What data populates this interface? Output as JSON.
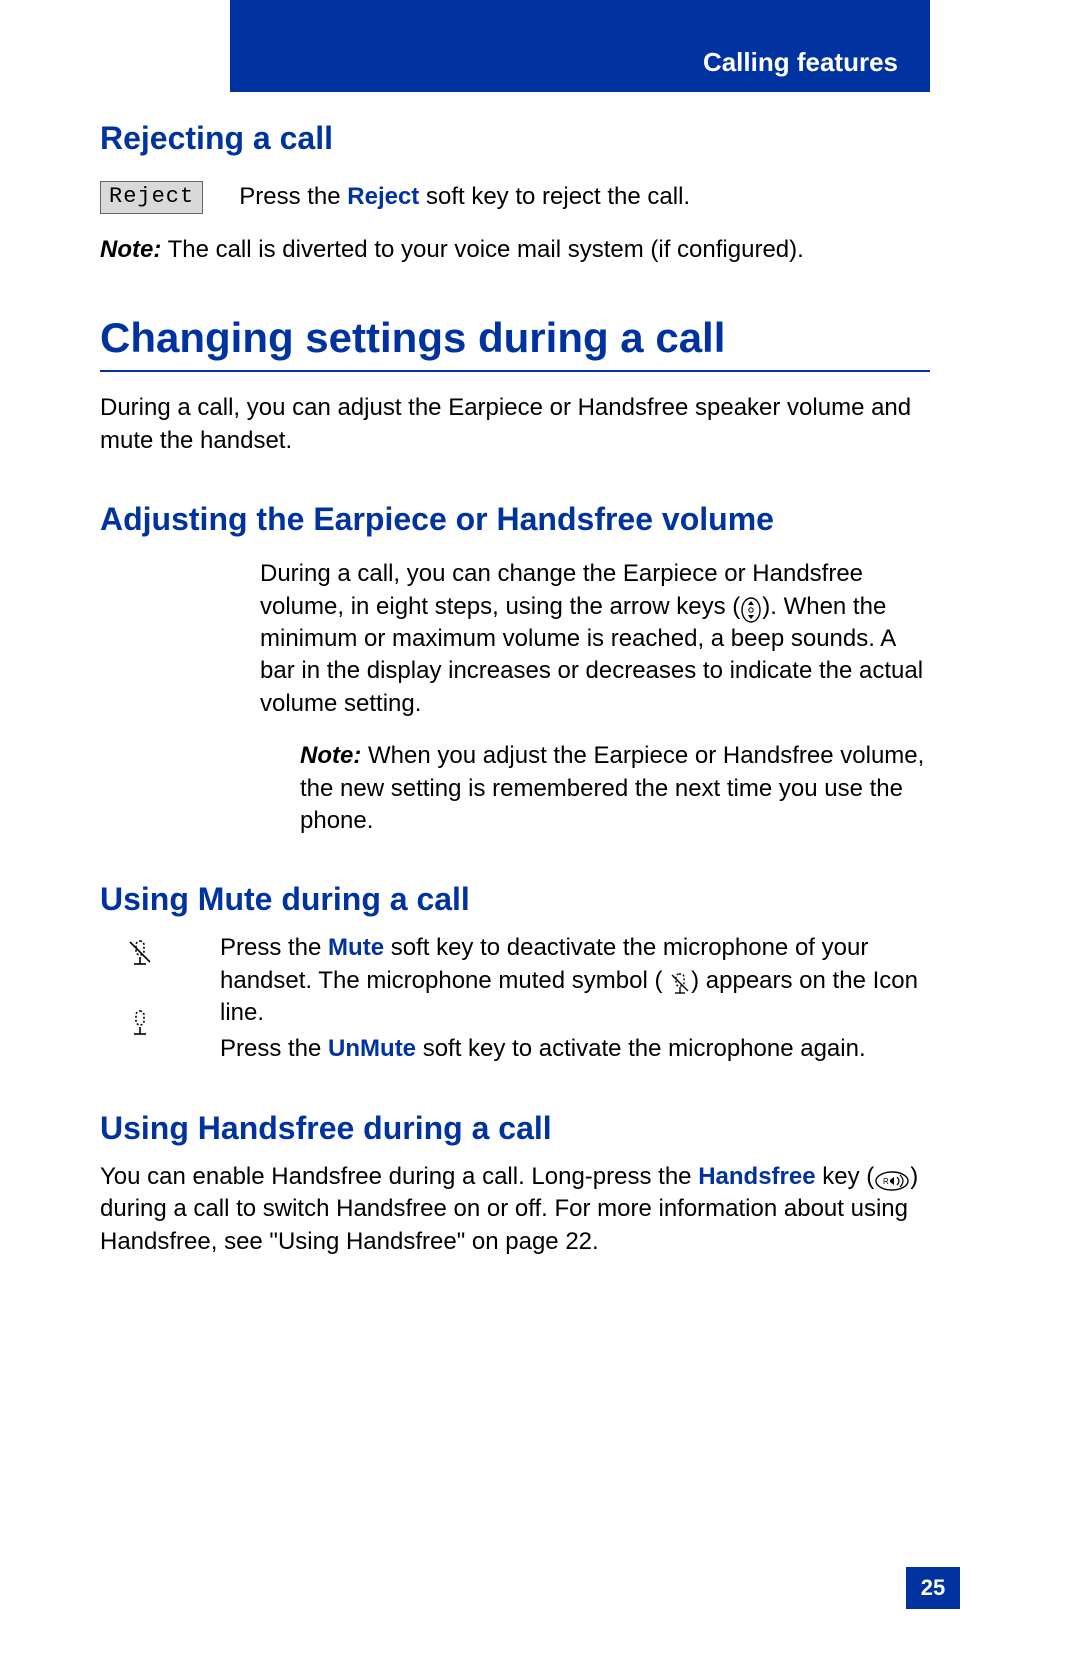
{
  "header": {
    "section": "Calling features"
  },
  "rejecting": {
    "heading": "Rejecting a call",
    "button_label": "Reject",
    "text_before": "Press the ",
    "text_key": "Reject",
    "text_after": " soft key to reject the call.",
    "note_label": "Note:",
    "note_text": " The call is diverted to your voice mail system (if configured)."
  },
  "changing": {
    "heading": "Changing settings during a call",
    "intro": "During a call, you can adjust the Earpiece or Handsfree speaker volume and mute the handset."
  },
  "adjusting": {
    "heading": "Adjusting the Earpiece or Handsfree volume",
    "text_a": "During a call, you can change the Earpiece or Handsfree volume, in eight steps, using the arrow keys (",
    "text_b": "). When the minimum or maximum volume is reached, a beep sounds. A bar in the display increases or decreases to indicate the actual volume setting.",
    "note_label": "Note:",
    "note_text": " When you adjust the Earpiece or Handsfree volume, the new setting is remembered the next time you use the phone."
  },
  "mute": {
    "heading": "Using Mute during a call",
    "line1_a": "Press the ",
    "line1_key": "Mute",
    "line1_b": " soft key to deactivate the microphone of your handset. The microphone muted symbol (",
    "line1_c": ") appears on the Icon line.",
    "line2_a": "Press the ",
    "line2_key": "UnMute",
    "line2_b": " soft key to activate the microphone again."
  },
  "handsfree": {
    "heading": "Using Handsfree during a call",
    "text_a": "You can enable Handsfree during a call. Long-press the ",
    "text_key": "Handsfree",
    "text_b": " key (",
    "text_c": ") during a call to switch Handsfree on or off. For more information about using Handsfree, see \"Using Handsfree\" on page 22."
  },
  "page_number": "25"
}
